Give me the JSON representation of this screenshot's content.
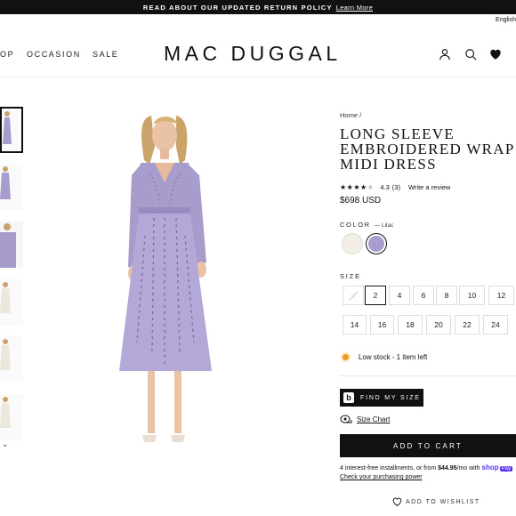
{
  "announcement": {
    "text": "READ ABOUT OUR UPDATED RETURN POLICY",
    "link": "Learn More"
  },
  "language": "English",
  "nav": {
    "items": [
      "OP",
      "OCCASION",
      "SALE"
    ]
  },
  "brand": "MAC DUGGAL",
  "header_icons": [
    "user-icon",
    "search-icon",
    "heart-icon"
  ],
  "gallery": {
    "thumbnail_count": 6,
    "selected_index": 0
  },
  "product": {
    "breadcrumb": "Home /",
    "title": "LONG SLEEVE\nEMBROIDERED WRAP\nMIDI DRESS",
    "rating": {
      "stars": 4.3,
      "value": "4.3",
      "count": "(3)",
      "write_review": "Write a review"
    },
    "price": "$698 USD",
    "color": {
      "label": "COLOR",
      "selected": "— Lilac",
      "swatches": [
        "#f3efe6",
        "#a89ccc"
      ],
      "selected_index": 1
    },
    "size": {
      "label": "SIZE",
      "options": [
        "0",
        "2",
        "4",
        "6",
        "8",
        "10",
        "12",
        "14",
        "16",
        "18",
        "20",
        "22",
        "24"
      ],
      "selected": "2",
      "unavailable": [
        "0"
      ]
    },
    "stock": "Low stock - 1 item left",
    "find_my_size": "FIND MY SIZE",
    "size_chart": "Size Chart",
    "add_to_cart": "ADD TO CART",
    "installments": {
      "prefix": "4 interest-free installments, or from ",
      "amount": "$44.95",
      "suffix": "/mo with ",
      "shop": "shop",
      "pay": "Pay"
    },
    "check_power": "Check your purchasing power",
    "wishlist": "ADD TO WISHLIST"
  },
  "colors": {
    "lilac": "#a89ccc",
    "stock_dot": "#f39a1e",
    "shop_pay": "#5a31f4"
  }
}
